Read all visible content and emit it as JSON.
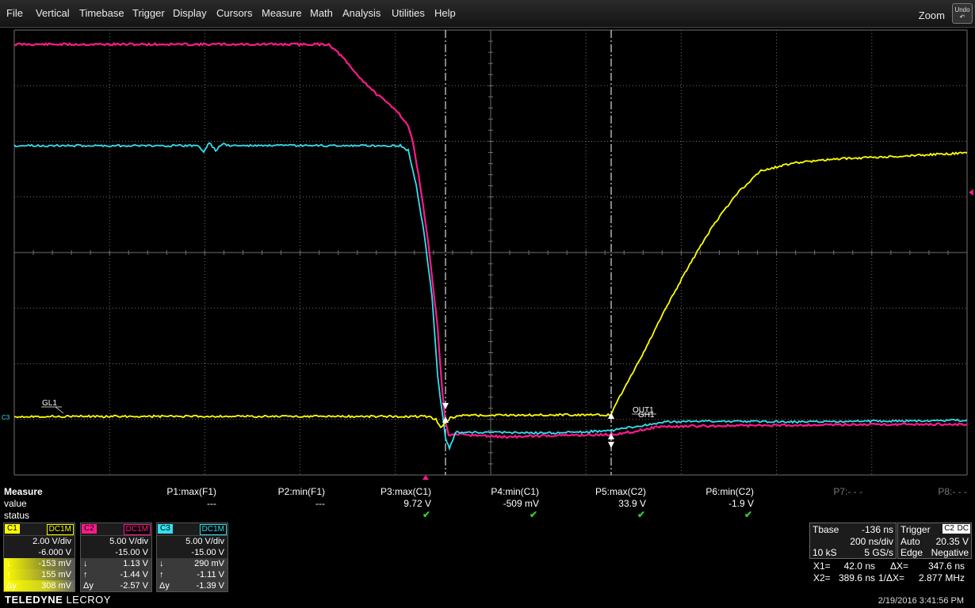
{
  "menu": {
    "items": [
      "File",
      "Vertical",
      "Timebase",
      "Trigger",
      "Display",
      "Cursors",
      "Measure",
      "Math",
      "Analysis",
      "Utilities",
      "Help"
    ],
    "zoom": "Zoom",
    "undo": "Undo"
  },
  "colors": {
    "c1": "#ffff00",
    "c2": "#ff1a8c",
    "c3": "#33e0f0",
    "grid": "#707070",
    "measure_ok": "#33cc33"
  },
  "scope": {
    "labels": {
      "gl1": "GL1",
      "out1": "OUT1",
      "gh1": "GH1",
      "c3_marker": "C3"
    }
  },
  "measure": {
    "title": "Measure",
    "row_value": "value",
    "row_status": "status",
    "params": [
      {
        "name": "P1:max(F1)",
        "value": "---",
        "ok": false
      },
      {
        "name": "P2:min(F1)",
        "value": "---",
        "ok": false
      },
      {
        "name": "P3:max(C1)",
        "value": "9.72 V",
        "ok": true
      },
      {
        "name": "P4:min(C1)",
        "value": "-509 mV",
        "ok": true
      },
      {
        "name": "P5:max(C2)",
        "value": "33.9 V",
        "ok": true
      },
      {
        "name": "P6:min(C2)",
        "value": "-1.9 V",
        "ok": true
      },
      {
        "name": "P7:- - -",
        "value": "",
        "ok": false
      },
      {
        "name": "P8:- - -",
        "value": "",
        "ok": false
      }
    ],
    "check": "✔"
  },
  "channels": [
    {
      "tag": "C1",
      "coupling": "DC1M",
      "vdiv": "2.00 V/div",
      "offset": "-6.000 V",
      "down": "-153 mV",
      "up": "155 mV",
      "dy": "308 mV"
    },
    {
      "tag": "C2",
      "coupling": "DC1M",
      "vdiv": "5.00 V/div",
      "offset": "-15.00 V",
      "down": "1.13 V",
      "up": "-1.44 V",
      "dy": "-2.57 V"
    },
    {
      "tag": "C3",
      "coupling": "DC1M",
      "vdiv": "5.00 V/div",
      "offset": "-15.00 V",
      "down": "290 mV",
      "up": "-1.11 V",
      "dy": "-1.39 V"
    }
  ],
  "channel_symbols": {
    "down": "↓",
    "up": "↑",
    "dy": "Δy"
  },
  "timebase": {
    "label": "Tbase",
    "delay": "-136 ns",
    "tdiv": "200 ns/div",
    "samples": "10 kS",
    "rate": "5 GS/s"
  },
  "trigger": {
    "label": "Trigger",
    "source": "C2",
    "coupling": "DC",
    "mode": "Auto",
    "level": "20.35 V",
    "type": "Edge",
    "slope": "Negative"
  },
  "cursors": {
    "x1_label": "X1=",
    "x1": "42.0 ns",
    "dx_label": "ΔX=",
    "dx": "347.6 ns",
    "x2_label": "X2=",
    "x2": "389.6 ns",
    "inv_label": "1/ΔX=",
    "inv": "2.877 MHz"
  },
  "brand": {
    "name": "TELEDYNE",
    "sub": " LECROY"
  },
  "timestamp": "2/19/2016 3:41:56 PM"
}
